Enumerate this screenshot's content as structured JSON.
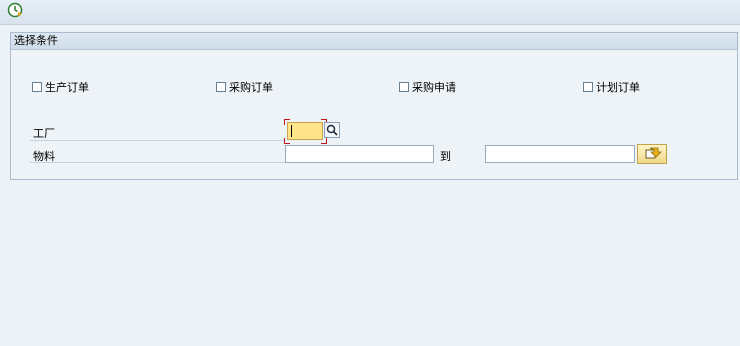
{
  "toolbar": {
    "execute_icon": "execute-clock-icon"
  },
  "frame": {
    "title": "选择条件"
  },
  "checkboxes": [
    {
      "label": "生产订单",
      "checked": false
    },
    {
      "label": "采购订单",
      "checked": false
    },
    {
      "label": "采购申请",
      "checked": false
    },
    {
      "label": "计划订单",
      "checked": false
    }
  ],
  "fields": {
    "plant": {
      "label": "工厂",
      "value": ""
    },
    "material": {
      "label": "物料",
      "from_value": "",
      "to_label": "到",
      "to_value": ""
    }
  },
  "colors": {
    "focus_input": "#ffe48a",
    "accent_red": "#c2161c"
  }
}
